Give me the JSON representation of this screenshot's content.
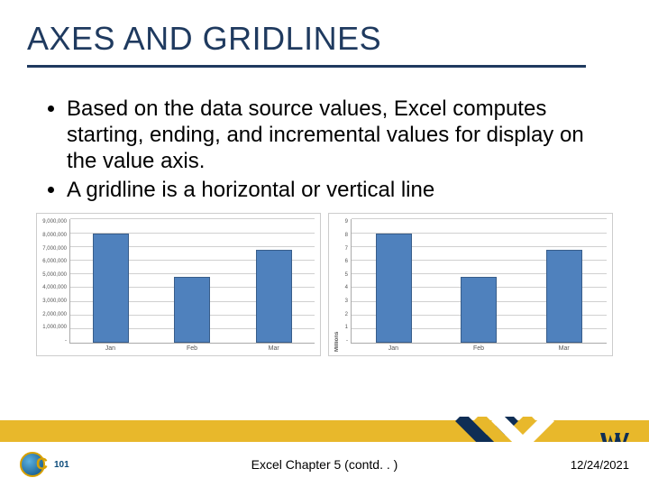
{
  "title": "AXES AND GRIDLINES",
  "bullets": [
    "Based on the data source values, Excel computes starting, ending, and incremental values for display on the value axis.",
    "A gridline is a horizontal or vertical line"
  ],
  "chart_data": [
    {
      "type": "bar",
      "title": "",
      "xlabel": "",
      "ylabel": "",
      "categories": [
        "Jan",
        "Feb",
        "Mar"
      ],
      "values": [
        8000000,
        4800000,
        6800000
      ],
      "ylim": [
        0,
        9000000
      ],
      "ytick_labels": [
        "9,000,000",
        "8,000,000",
        "7,000,000",
        "6,000,000",
        "5,000,000",
        "4,000,000",
        "3,000,000",
        "2,000,000",
        "1,000,000",
        "-"
      ]
    },
    {
      "type": "bar",
      "title": "",
      "xlabel": "",
      "ylabel": "Millions",
      "categories": [
        "Jan",
        "Feb",
        "Mar"
      ],
      "values": [
        8,
        4.8,
        6.8
      ],
      "ylim": [
        0,
        9
      ],
      "ytick_labels": [
        "9",
        "8",
        "7",
        "6",
        "5",
        "4",
        "3",
        "2",
        "1",
        "-"
      ]
    }
  ],
  "footer": {
    "center": "Excel Chapter 5 (contd. . )",
    "date": "12/24/2021",
    "page_overlay": ""
  }
}
